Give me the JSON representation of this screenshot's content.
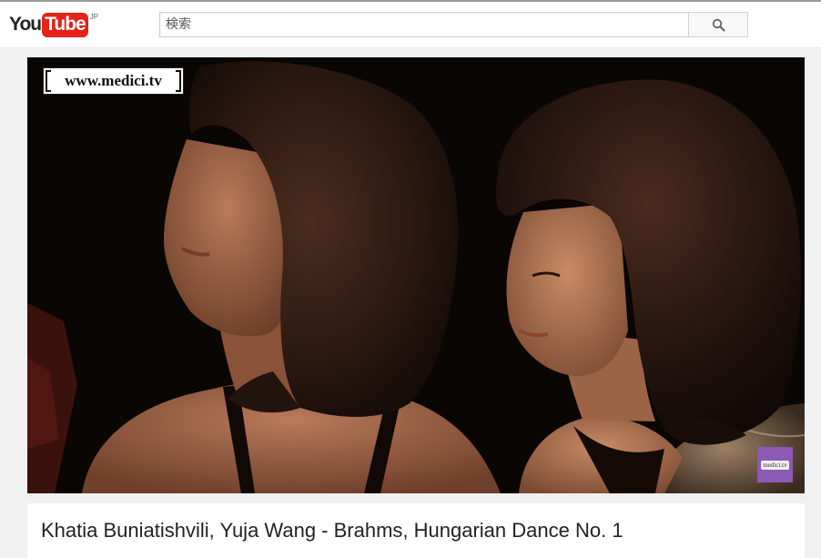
{
  "masthead": {
    "logo": {
      "you": "You",
      "tube": "Tube",
      "region": "JP"
    },
    "search": {
      "placeholder": "検索",
      "button_icon": "search-icon"
    }
  },
  "player": {
    "watermark": "www.medici.tv",
    "corner_logo": "medici.tv"
  },
  "video": {
    "title": "Khatia Buniatishvili, Yuja Wang - Brahms, Hungarian Dance No. 1"
  },
  "colors": {
    "brand_red": "#e62117",
    "page_bg": "#f1f1f1",
    "corner_logo_bg": "#8a5ab5"
  }
}
